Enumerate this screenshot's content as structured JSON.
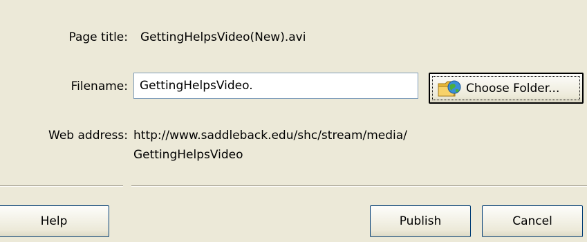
{
  "fields": {
    "page_title_label": "Page title:",
    "page_title_value": "GettingHelpsVideo(New).avi",
    "filename_label": "Filename:",
    "filename_value": "GettingHelpsVideo.",
    "web_address_label": "Web address:",
    "web_address_line1": "http://www.saddleback.edu/shc/stream/media/",
    "web_address_line2": "GettingHelpsVideo"
  },
  "buttons": {
    "choose_folder": "Choose Folder...",
    "help": "Help",
    "publish": "Publish",
    "cancel": "Cancel"
  },
  "icons": {
    "choose_folder_icon": "folder-globe-icon"
  },
  "colors": {
    "dialog_background": "#ece9d8",
    "input_border": "#7f9db9",
    "button_border": "#003c74"
  }
}
